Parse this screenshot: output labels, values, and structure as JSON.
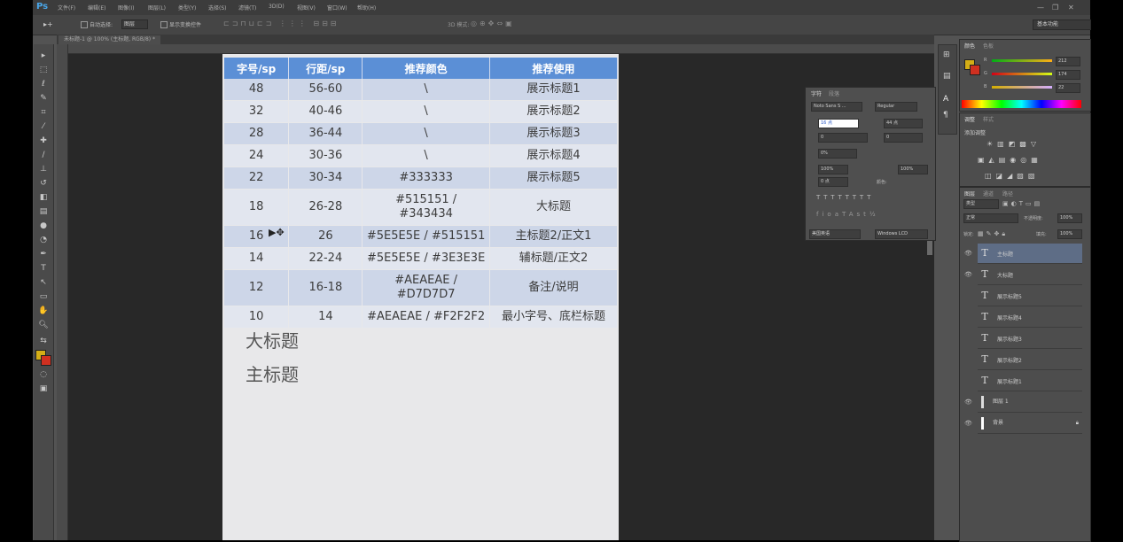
{
  "app": {
    "logo": "Ps",
    "menu": [
      "文件(F)",
      "编辑(E)",
      "图像(I)",
      "图层(L)",
      "类型(Y)",
      "选择(S)",
      "滤镜(T)",
      "3D(D)",
      "视图(V)",
      "窗口(W)",
      "帮助(H)"
    ],
    "workspace": "基本功能",
    "doc_tab": "未标题-1 @ 100% (主标题, RGB/8) *"
  },
  "options": {
    "auto_select": "自动选择:",
    "auto_select_value": "图层",
    "show_transform": "显示变换控件",
    "mode_3d": "3D 模式:"
  },
  "spec_table": {
    "headers": [
      "字号/sp",
      "行距/sp",
      "推荐颜色",
      "推荐使用"
    ],
    "rows": [
      [
        "48",
        "56-60",
        "\\",
        "展示标题1"
      ],
      [
        "32",
        "40-46",
        "\\",
        "展示标题2"
      ],
      [
        "28",
        "36-44",
        "\\",
        "展示标题3"
      ],
      [
        "24",
        "30-36",
        "\\",
        "展示标题4"
      ],
      [
        "22",
        "30-34",
        "#333333",
        "展示标题5"
      ],
      [
        "18",
        "26-28",
        "#515151 / #343434",
        "大标题"
      ],
      [
        "16",
        "26",
        "#5E5E5E / #515151",
        "主标题2/正文1"
      ],
      [
        "14",
        "22-24",
        "#5E5E5E / #3E3E3E",
        "辅标题/正文2"
      ],
      [
        "12",
        "16-18",
        "#AEAEAE / #D7D7D7",
        "备注/说明"
      ],
      [
        "10",
        "14",
        "#AEAEAE / #F2F2F2",
        "最小字号、底栏标题"
      ]
    ]
  },
  "canvas_text": {
    "big_title": "大标题",
    "main_title": "主标题"
  },
  "char_panel": {
    "tabs": [
      "字符",
      "段落"
    ],
    "font": "Noto Sans S ...",
    "style": "Regular",
    "size": "16 点",
    "leading": "44 点",
    "kerning": "0",
    "tracking": "0",
    "scale_v": "0%",
    "vscale": "100%",
    "hscale": "100%",
    "baseline": "0 点",
    "color_label": "颜色:",
    "lang": "美国英语",
    "aa": "Windows LCD"
  },
  "color_panel": {
    "tabs": [
      "颜色",
      "色板"
    ],
    "r": "212",
    "g": "174",
    "b": "22"
  },
  "adjust_panel": {
    "tabs": [
      "调整",
      "样式"
    ],
    "title": "添加调整"
  },
  "layers_panel": {
    "tabs": [
      "图层",
      "通道",
      "路径"
    ],
    "kind": "类型",
    "blend": "正常",
    "opacity_label": "不透明度:",
    "opacity": "100%",
    "lock_label": "锁定:",
    "fill_label": "填充:",
    "fill": "100%",
    "layers": [
      {
        "type": "text",
        "name": "主标题",
        "selected": true
      },
      {
        "type": "text",
        "name": "大标题",
        "selected": false
      },
      {
        "type": "text",
        "name": "展示标题5",
        "selected": false
      },
      {
        "type": "text",
        "name": "展示标题4",
        "selected": false
      },
      {
        "type": "text",
        "name": "展示标题3",
        "selected": false
      },
      {
        "type": "text",
        "name": "展示标题2",
        "selected": false
      },
      {
        "type": "text",
        "name": "展示标题1",
        "selected": false
      },
      {
        "type": "fill",
        "name": "图层 1",
        "selected": false
      },
      {
        "type": "fill",
        "name": "背景",
        "selected": false
      }
    ]
  },
  "colors": {
    "accent": "#5b8fd6",
    "foreground": "#d4ae16",
    "background": "#d03020"
  }
}
